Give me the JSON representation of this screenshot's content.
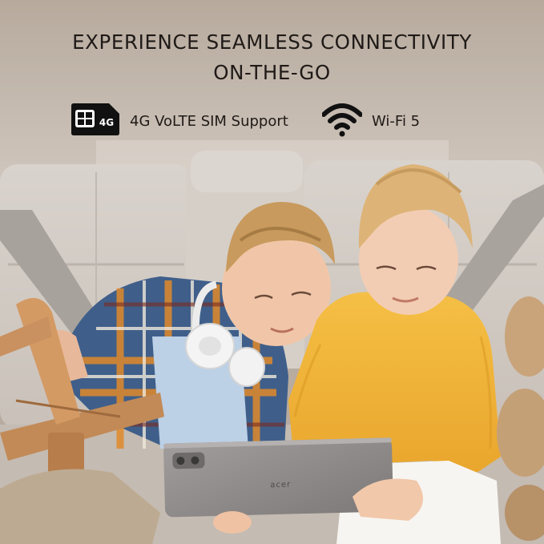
{
  "headline": {
    "line1": "EXPERIENCE SEAMLESS CONNECTIVITY",
    "line2": "ON-THE-GO"
  },
  "features": [
    {
      "icon": "sim-card-icon",
      "badge": "4G",
      "label": "4G VoLTE SIM Support"
    },
    {
      "icon": "wifi-icon",
      "label": "Wi-Fi 5"
    }
  ],
  "tablet": {
    "logo": "acer"
  },
  "colors": {
    "background": "#b8ab9f",
    "text": "#1f1a17",
    "sweater": "#f2b53a",
    "tablet": "#8f8b8a"
  }
}
